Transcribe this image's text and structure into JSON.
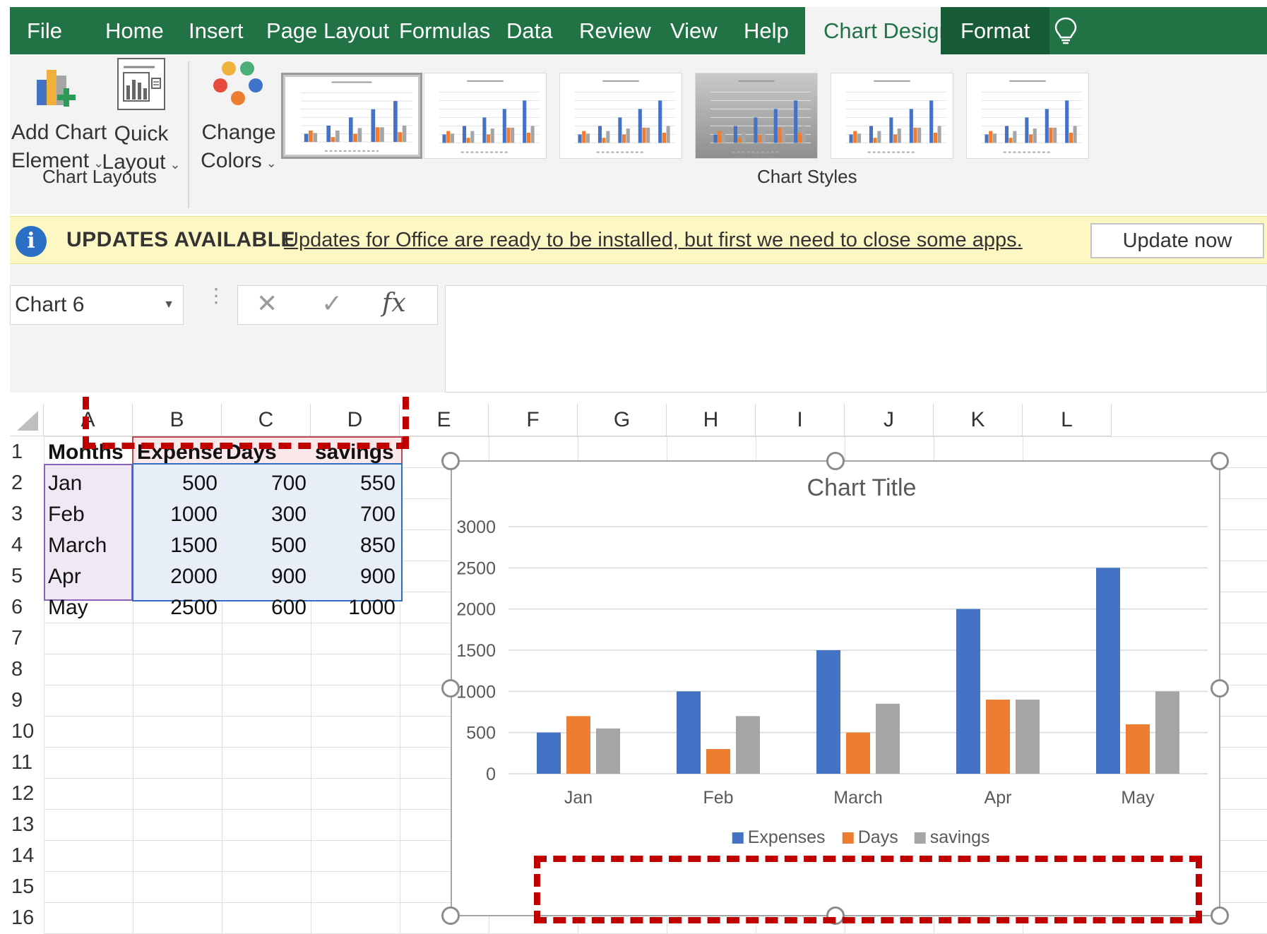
{
  "ribbon": {
    "tabs": [
      "File",
      "Home",
      "Insert",
      "Page Layout",
      "Formulas",
      "Data",
      "Review",
      "View",
      "Help",
      "Chart Design",
      "Format"
    ],
    "active_tab": "Chart Design",
    "buttons": {
      "add_chart_element": [
        "Add Chart",
        "Element"
      ],
      "quick_layout": [
        "Quick",
        "Layout"
      ],
      "change_colors": [
        "Change",
        "Colors"
      ]
    },
    "groups": {
      "chart_layouts": "Chart Layouts",
      "chart_styles": "Chart Styles"
    },
    "icons": [
      "add-chart-element-icon",
      "quick-layout-icon",
      "change-colors-icon",
      "lightbulb-icon"
    ]
  },
  "update_bar": {
    "title": "UPDATES AVAILABLE",
    "message": "Updates for Office are ready to be installed, but first we need to close some apps.",
    "button": "Update now",
    "icon": "info-icon"
  },
  "formula_bar": {
    "name_box": "Chart 6",
    "fx_label": "fx",
    "formula": ""
  },
  "sheet": {
    "columns": [
      "A",
      "B",
      "C",
      "D",
      "E",
      "F",
      "G",
      "H",
      "I",
      "J",
      "K",
      "L"
    ],
    "rows": [
      "1",
      "2",
      "3",
      "4",
      "5",
      "6",
      "7",
      "8",
      "9",
      "10",
      "11",
      "12",
      "13",
      "14",
      "15",
      "16"
    ],
    "table": {
      "headers": [
        "Months",
        "Expenses",
        "Days",
        "savings"
      ],
      "rows": [
        [
          "Jan",
          "500",
          "700",
          "550"
        ],
        [
          "Feb",
          "1000",
          "300",
          "700"
        ],
        [
          "March",
          "1500",
          "500",
          "850"
        ],
        [
          "Apr",
          "2000",
          "900",
          "900"
        ],
        [
          "May",
          "2500",
          "600",
          "1000"
        ]
      ]
    }
  },
  "colors": {
    "excel_green": "#217346",
    "expenses": "#4472C4",
    "days": "#ED7D31",
    "savings": "#A5A5A5",
    "annotation_red": "#C00000"
  },
  "chart_data": {
    "type": "bar",
    "title": "Chart Title",
    "categories": [
      "Jan",
      "Feb",
      "March",
      "Apr",
      "May"
    ],
    "series": [
      {
        "name": "Expenses",
        "values": [
          500,
          1000,
          1500,
          2000,
          2500
        ],
        "color": "#4472C4"
      },
      {
        "name": "Days",
        "values": [
          700,
          300,
          500,
          900,
          600
        ],
        "color": "#ED7D31"
      },
      {
        "name": "savings",
        "values": [
          550,
          700,
          850,
          900,
          1000
        ],
        "color": "#A5A5A5"
      }
    ],
    "ylim": [
      0,
      3000
    ],
    "yticks": [
      0,
      500,
      1000,
      1500,
      2000,
      2500,
      3000
    ],
    "grid": true,
    "legend": "bottom",
    "xlabel": "",
    "ylabel": ""
  }
}
